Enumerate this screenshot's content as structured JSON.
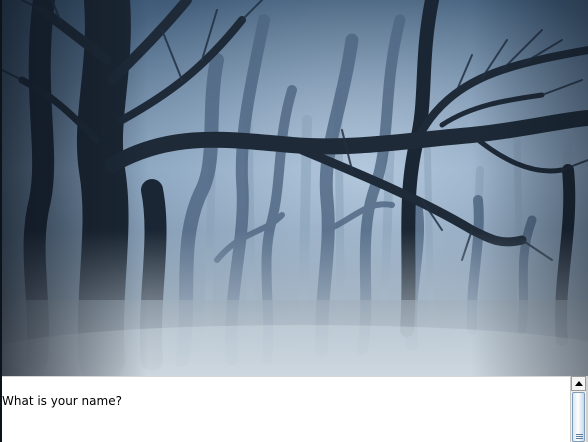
{
  "scene": {
    "image": "misty-forest-icon",
    "colors": {
      "sky": "#6f8aa6",
      "fog": "#b9c7d4",
      "trunk": "#1b2634",
      "ground": "#8f9eab"
    }
  },
  "output": {
    "lines": [
      "What is your name?"
    ]
  }
}
